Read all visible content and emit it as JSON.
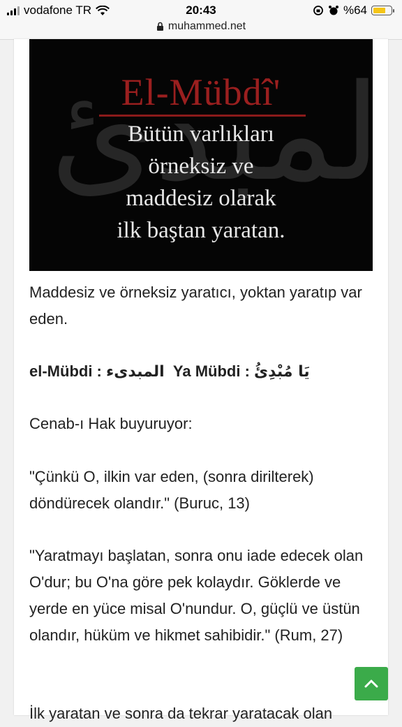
{
  "status_bar": {
    "carrier": "vodafone TR",
    "time": "20:43",
    "battery": "%64",
    "url": "muhammed.net"
  },
  "hero": {
    "calligraphy": "المبدئ",
    "title": "El-Mübdî'",
    "lines": [
      "Bütün varlıkları",
      "örneksiz ve",
      "maddesiz olarak",
      "ilk baştan yaratan."
    ]
  },
  "article": {
    "definition": "Maddesiz ve örneksiz yaratıcı, yoktan yaratıp var eden.",
    "name_line": {
      "name_latin": "el-Mübdi :",
      "name_arabic": "المبدىء",
      "call_latin": "Ya Mübdi :",
      "call_arabic": "يَا مُبْدِئُ"
    },
    "intro": "Cenab-ı Hak buyuruyor:",
    "quote1": "\"Çünkü O, ilkin var eden, (sonra dirilterek) döndürecek olandır.\" (Buruc, 13)",
    "quote2": "\"Yaratmayı başlatan, sonra onu iade edecek olan O'dur; bu O'na göre pek kolaydır. Göklerde ve yerde en yüce misal O'nundur. O, güçlü ve üstün olandır, hüküm ve hikmet sahibidir.\" (Rum, 27)",
    "partial": "İlk yaratan ve sonra da tekrar yaratacak olan"
  },
  "colors": {
    "scroll_button": "#3bab4a",
    "hero_title": "#9b1f1f"
  }
}
